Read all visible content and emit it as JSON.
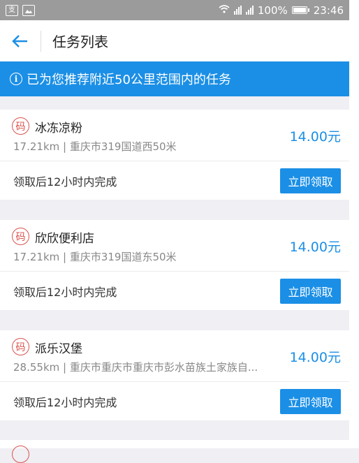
{
  "status_bar": {
    "left_icons": [
      "alipay-icon",
      "image-icon"
    ],
    "battery": "100%",
    "time": "23:46"
  },
  "header": {
    "title": "任务列表"
  },
  "banner": {
    "text": "已为您推荐附近50公里范围内的任务"
  },
  "tasks": [
    {
      "badge": "码",
      "name": "冰冻凉粉",
      "meta": "17.21km | 重庆市319国道西50米",
      "price": "14.00元",
      "deadline": "领取后12小时内完成",
      "button": "立即领取"
    },
    {
      "badge": "码",
      "name": "欣欣便利店",
      "meta": "17.21km | 重庆市319国道东50米",
      "price": "14.00元",
      "deadline": "领取后12小时内完成",
      "button": "立即领取"
    },
    {
      "badge": "码",
      "name": "派乐汉堡",
      "meta": "28.55km | 重庆市重庆市重庆市彭水苗族土家族自...",
      "price": "14.00元",
      "deadline": "领取后12小时内完成",
      "button": "立即领取"
    }
  ],
  "colors": {
    "accent": "#1b8fe6",
    "badge": "#d9534f",
    "status_bar": "#9b9b9b"
  }
}
